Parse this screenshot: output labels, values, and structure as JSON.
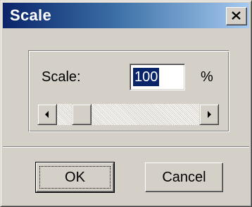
{
  "window": {
    "title": "Scale"
  },
  "titlebar": {
    "close_label": "X"
  },
  "scale": {
    "label": "Scale:",
    "value": "100",
    "unit": "%"
  },
  "slider": {
    "position_fraction": 0.12
  },
  "buttons": {
    "ok_label": "OK",
    "cancel_label": "Cancel"
  },
  "colors": {
    "titlebar_start": "#0a246a",
    "titlebar_end": "#a6caf0",
    "face": "#d4d0c8",
    "selection": "#0a246a"
  }
}
